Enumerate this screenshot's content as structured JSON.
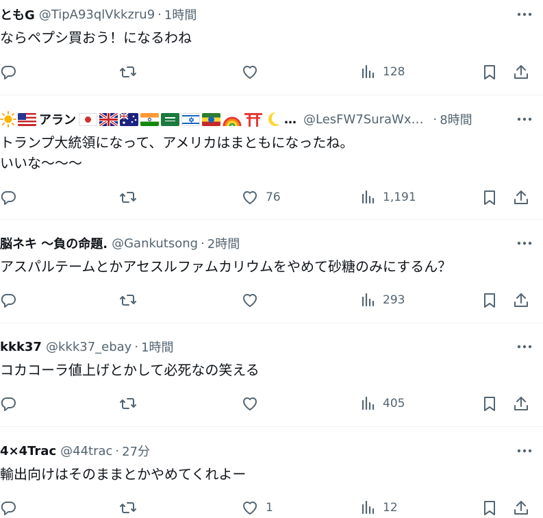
{
  "tweets": [
    {
      "name": "ともG",
      "handle": "@TipA93qlVkkzru9",
      "time": "1時間",
      "text_lines": [
        "ならペプシ買おう！になるわね"
      ],
      "likes": "",
      "views": "128"
    },
    {
      "name": "アラン",
      "name_prefix_icons": [
        "sun-emoji",
        "us-flag-emoji"
      ],
      "name_suffix_icons": [
        "japan-flag-emoji",
        "uk-flag-emoji",
        "australia-flag-emoji",
        "india-flag-emoji",
        "saudi-flag-emoji",
        "israel-flag-emoji",
        "ethiopia-flag-emoji",
        "rainbow-emoji",
        "torii-emoji",
        "crescent-moon-emoji"
      ],
      "name_ellipsis": "…",
      "handle": "@LesFW7SuraWx…",
      "time": "8時間",
      "text_lines": [
        "トランプ大統領になって、アメリカはまともになったね。",
        "いいな〜〜〜"
      ],
      "likes": "76",
      "views": "1,191"
    },
    {
      "name": "脳ネキ 〜負の命題.",
      "handle": "@Gankutsong",
      "time": "2時間",
      "text_lines": [
        "アスパルテームとかアセスルファムカリウムをやめて砂糖のみにするん？"
      ],
      "likes": "",
      "views": "293"
    },
    {
      "name": "kkk37",
      "handle": "@kkk37_ebay",
      "time": "1時間",
      "text_lines": [
        "コカコーラ値上げとかして必死なの笑える"
      ],
      "likes": "",
      "views": "405"
    },
    {
      "name": "4×4Trac",
      "handle": "@44trac",
      "time": "27分",
      "text_lines": [
        "輸出向けはそのままとかやめてくれよー"
      ],
      "likes": "1",
      "views": "12"
    }
  ],
  "dot": "·",
  "icons": {
    "reply": "reply-icon",
    "retweet": "retweet-icon",
    "like": "heart-icon",
    "views": "views-icon",
    "bookmark": "bookmark-icon",
    "share": "share-icon",
    "more": "more-icon"
  },
  "colors": {
    "text": "#0f1419",
    "secondary": "#536471",
    "divider": "#eff3f4"
  }
}
